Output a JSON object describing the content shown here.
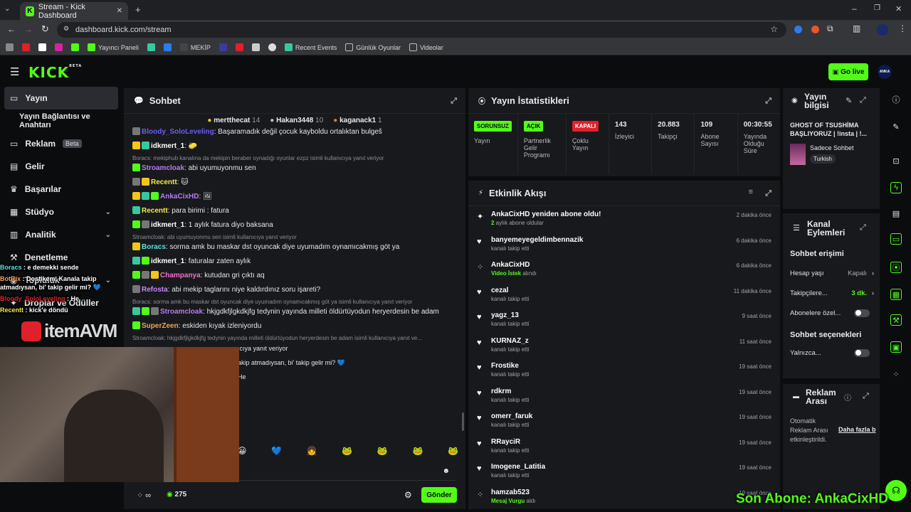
{
  "browser": {
    "tab_title": "Stream - Kick Dashboard",
    "url": "dashboard.kick.com/stream",
    "bookmarks": [
      "",
      "",
      "",
      "Yayıncı Paneli",
      "",
      "",
      "MEKİP",
      "",
      "",
      "",
      "",
      "Recent Events",
      "Günlük Oyunlar",
      "Videolar"
    ]
  },
  "header": {
    "logo": "KICK",
    "logo_sup": "BETA",
    "go_live": "Go live",
    "avatar": "ANKA"
  },
  "sidebar": {
    "items": [
      {
        "label": "Yayın",
        "icon": "camera-icon"
      },
      {
        "label": "Yayın Bağlantısı ve Anahtarı",
        "icon": ""
      },
      {
        "label": "Reklam",
        "icon": "tv-icon",
        "badge": "Beta"
      },
      {
        "label": "Gelir",
        "icon": "chart-icon"
      },
      {
        "label": "Başarılar",
        "icon": "trophy-icon"
      },
      {
        "label": "Stüdyo",
        "icon": "studio-icon"
      },
      {
        "label": "Analitik",
        "icon": "analytics-icon"
      },
      {
        "label": "Denetleme",
        "icon": "hammer-icon"
      },
      {
        "label": "Topluluk",
        "icon": "community-icon"
      },
      {
        "label": "Droplar ve Ödüller",
        "icon": "gift-icon"
      }
    ]
  },
  "chat": {
    "title": "Sohbet",
    "top_gifters": [
      {
        "name": "mertthecat",
        "count": "14"
      },
      {
        "name": "Hakan3448",
        "count": "10"
      },
      {
        "name": "kaganack1",
        "count": "1"
      }
    ],
    "messages": [
      {
        "type": "msg",
        "user": "Bloody_SoloLeveling",
        "color": "#6b5cf6",
        "text": ": Başaramadık değil çocuk kayboldu ortalıktan bulgeš"
      },
      {
        "type": "msg",
        "user": "idkmert_1",
        "color": "#ffffff",
        "text": ": 🧽"
      },
      {
        "type": "reply",
        "text": "Boracs: mekiphub kanalına da mekipin beraber oynadığı oyunlar ezpz isimli kullanıcıya yanıt veriyor"
      },
      {
        "type": "msg",
        "user": "Stroamcloak",
        "color": "#b77cf5",
        "text": ": abi uyumuyonmu sen"
      },
      {
        "type": "msg",
        "user": "Recentt",
        "color": "#f3e94a",
        "text": ": 🐱"
      },
      {
        "type": "msg",
        "user": "AnkaCixHD",
        "color": "#b77cf5",
        "text": ": 🖼"
      },
      {
        "type": "msg",
        "user": "Recentt",
        "color": "#f3e94a",
        "text": ": para birimi : fatura"
      },
      {
        "type": "msg",
        "user": "idkmert_1",
        "color": "#ffffff",
        "text": ": 1 aylık fatura diyo baksana"
      },
      {
        "type": "reply",
        "text": "Stroamcloak: abi uyumuyonmu sen isimli kullanıcıya yanıt veriyor"
      },
      {
        "type": "msg",
        "user": "Boracs",
        "color": "#5ae0e6",
        "text": ": sorma amk bu maskar dst oyuncak diye uyumadım oynamıcakmış göt ya"
      },
      {
        "type": "msg",
        "user": "idkmert_1",
        "color": "#ffffff",
        "text": ": faturalar zaten aylık"
      },
      {
        "type": "msg",
        "user": "Champanya",
        "color": "#f56fd0",
        "text": ": kutudan gri çıktı aq"
      },
      {
        "type": "msg",
        "user": "Refosta",
        "color": "#c58af9",
        "text": ": abi mekip taglarını niye kaldırdınız soru işareti?"
      },
      {
        "type": "reply",
        "text": "Boracs: sorma amk bu maskar dst oyuncak diye uyumadım oynamıcakmış göt ya isimli kullanıcıya yanıt veriyor"
      },
      {
        "type": "msg",
        "user": "Stroamcloak",
        "color": "#b77cf5",
        "text": ": hkjgdkfjlgkdkjfg tedynin yayında milleti öldürtüyodun heryerdesin be adam"
      },
      {
        "type": "msg",
        "user": "SuperZeen",
        "color": "#f5a25a",
        "text": ": eskiden kıyak izleniyordu"
      },
      {
        "type": "reply",
        "text": "Stroamcloak: hkjgdkfjlgkdkjfg tedynin yayında milleti öldürtüyodun heryerdesin be adam isimli kullanıcıya yanıt ve..."
      },
      {
        "type": "partial",
        "text": "ıcıya yanıt veriyor"
      },
      {
        "type": "partial",
        "text": "akip atmadıysan, bi' takip gelir mi? 💙"
      },
      {
        "type": "partial",
        "text": "He"
      }
    ],
    "emotes": [
      "😀",
      "💙",
      "👧",
      "🐸",
      "🐸",
      "🐸",
      "🐸"
    ],
    "input_placeholder": "",
    "points": "275",
    "send_label": "Gönder"
  },
  "stats": {
    "title": "Yayın İstatistikleri",
    "items": [
      {
        "tag": "SORUNSUZ",
        "label": "Yayın",
        "tag_bg": "#53fc18"
      },
      {
        "tag": "AÇIK",
        "label": "Partnerlik Gelir Programı",
        "tag_bg": "#53fc18"
      },
      {
        "tag": "KAPALI",
        "label": "Çoklu Yayın",
        "tag_bg": "#e0202a"
      },
      {
        "value": "143",
        "label": "İzleyici"
      },
      {
        "value": "20.883",
        "label": "Takipçi"
      },
      {
        "value": "109",
        "label": "Abone Sayısı"
      },
      {
        "value": "00:30:55",
        "label": "Yayında Olduğu Süre"
      }
    ]
  },
  "events": {
    "title": "Etkinlik Akışı",
    "items": [
      {
        "icon": "sparkle-icon",
        "name": "AnkaCixHD yeniden abone oldu!",
        "sub_green": "2",
        "sub": " aylık abone oldular",
        "time": "2 dakika önce"
      },
      {
        "icon": "heart-icon",
        "name": "banyemeyegeldimbennazik",
        "sub": "kanalı takip etti",
        "time": "6 dakika önce"
      },
      {
        "icon": "kicks-icon",
        "name": "AnkaCixHD",
        "sub_green": "Video İstek",
        "sub": " alındı",
        "time": "6 dakika önce"
      },
      {
        "icon": "heart-icon",
        "name": "cezal",
        "sub": "kanalı takip etti",
        "time": "11 dakika önce"
      },
      {
        "icon": "heart-icon",
        "name": "yagz_13",
        "sub": "kanalı takip etti",
        "time": "9 saat önce"
      },
      {
        "icon": "heart-icon",
        "name": "KURNAZ_z",
        "sub": "kanalı takip etti",
        "time": "11 saat önce"
      },
      {
        "icon": "heart-icon",
        "name": "Frostike",
        "sub": "kanalı takip etti",
        "time": "19 saat önce"
      },
      {
        "icon": "heart-icon",
        "name": "rdkrm",
        "sub": "kanalı takip etti",
        "time": "19 saat önce"
      },
      {
        "icon": "heart-icon",
        "name": "omerr_faruk",
        "sub": "kanalı takip etti",
        "time": "19 saat önce"
      },
      {
        "icon": "heart-icon",
        "name": "RRayciR",
        "sub": "kanalı takip etti",
        "time": "19 saat önce"
      },
      {
        "icon": "heart-icon",
        "name": "Imogene_Latitia",
        "sub": "kanalı takip etti",
        "time": "19 saat önce"
      },
      {
        "icon": "kicks-icon",
        "name": "hamzab523",
        "sub_green": "Mesaj Vurgu",
        "sub": " aldı",
        "time": "19 saat önce"
      }
    ]
  },
  "stream_info": {
    "title": "Yayın bilgisi",
    "stream_title": "GHOST OF TSUSHİMA BAŞLIYORUZ | !insta | !...",
    "mode": "Sadece Sohbet",
    "language": "Turkish"
  },
  "channel_actions": {
    "title": "Kanal Eylemleri",
    "chat_access": "Sohbet erişimi",
    "rows": [
      {
        "label": "Hesap yaşı",
        "value": "Kapalı"
      },
      {
        "label": "Takipçilere...",
        "value": "3 dk."
      },
      {
        "label": "Abonelere özel...",
        "value": ""
      }
    ],
    "chat_options": "Sohbet seçenekleri",
    "only": "Yalnızca..."
  },
  "ad_break": {
    "title": "Reklam Arası",
    "text": "Otomatik Reklam Arası etkinleştirildi.",
    "link": "Daha fazla b"
  },
  "overlay": {
    "lines": [
      {
        "user": "Boracs",
        "text": " : e demekki sende",
        "color": "#5ae0e6"
      },
      {
        "user": "BotRix",
        "text": " : Dostikem, Kanala takip atmadıysan, bi' takip gelir mi? 💙",
        "color": "#f5a25a"
      },
      {
        "user": "Bloody_SoloLeveling",
        "text": " : He",
        "color": "#e0202a"
      },
      {
        "user": "Recentt",
        "text": " : kick'e döndü",
        "color": "#f3e94a"
      }
    ],
    "brand": "itemAVM",
    "last_sub": "Son Abone: AnkaCixHD"
  }
}
